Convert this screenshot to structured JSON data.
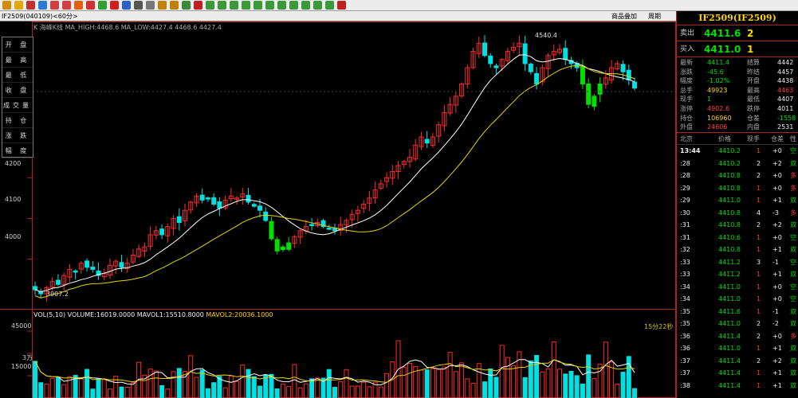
{
  "toolbar": {
    "icons": [
      "home-icon",
      "folder-icon",
      "grid-icon",
      "refresh-icon",
      "zoom-in-icon",
      "zoom-out-icon",
      "target-icon",
      "pencil-icon",
      "alert-icon",
      "filter-icon",
      "new-icon",
      "list-icon",
      "table-icon",
      "calendar-icon",
      "calendar-icon",
      "chart-icon",
      "close-icon",
      "1min-icon",
      "3min-icon",
      "5min-icon",
      "15min-icon",
      "30min-icon",
      "60min-icon",
      "day-icon",
      "week-icon",
      "month-icon",
      "quarter-icon",
      "year-icon",
      "settings-icon"
    ],
    "new_label": "新"
  },
  "tab": {
    "title": "IF2509(040109)<60分>",
    "overlay_label": "商品叠加",
    "period_label": "周期"
  },
  "menu": [
    "开 盘",
    "最 高",
    "最 低",
    "收 盘",
    "成交量",
    "持 仓",
    "涨 跌",
    "幅 度"
  ],
  "ma_line": "K 海峰K线  MA_HIGH:4468.6  MA_LOW:4427.4  4468.6  4427.4",
  "vol_line": {
    "a": "VOL(5,10) VOLUME:16019.0000",
    "b": "MAVOL1:15510.8000",
    "c": "MAVOL2:20036.1000"
  },
  "axis_price": [
    "4200",
    "4100",
    "4000"
  ],
  "axis_vol": [
    "45000",
    "3万",
    "15000"
  ],
  "peak_label": "4540.4",
  "low_label": "3907.2",
  "time_left": "15分22秒",
  "colors": {
    "up": "#ff2a2a",
    "down": "#00e0e0",
    "bull_green": "#00e000",
    "ma1": "#ffffff",
    "ma2": "#e6d300"
  },
  "chart_data": {
    "type": "candlestick",
    "price_ticks": [
      4000,
      4100,
      4200
    ],
    "volume_ticks": [
      15000,
      30000,
      45000
    ],
    "closes": [
      3925,
      3915,
      3930,
      3945,
      3938,
      3960,
      3975,
      3970,
      3990,
      3980,
      3975,
      3960,
      3965,
      3985,
      3995,
      3980,
      3990,
      4010,
      4025,
      4030,
      4060,
      4070,
      4060,
      4080,
      4100,
      4090,
      4120,
      4140,
      4155,
      4145,
      4150,
      4135,
      4125,
      4145,
      4155,
      4150,
      4160,
      4140,
      4130,
      4120,
      4095,
      4050,
      4020,
      4030,
      4040,
      4055,
      4070,
      4080,
      4085,
      4090,
      4080,
      4075,
      4070,
      4085,
      4095,
      4110,
      4120,
      4135,
      4150,
      4170,
      4185,
      4200,
      4215,
      4230,
      4240,
      4250,
      4280,
      4300,
      4285,
      4300,
      4330,
      4360,
      4380,
      4400,
      4430,
      4470,
      4510,
      4530,
      4500,
      4480,
      4470,
      4490,
      4510,
      4520,
      4530,
      4480,
      4460,
      4430,
      4470,
      4500,
      4510,
      4515,
      4490,
      4480,
      4470,
      4430,
      4380,
      4400,
      4430,
      4445,
      4470,
      4480,
      4460,
      4440,
      4420
    ],
    "current_price": 4411.6
  },
  "right": {
    "title": "IF2509(IF2509)",
    "sell_label": "卖出",
    "sell_price": "4411.6",
    "sell_qty": "2",
    "buy_label": "买入",
    "buy_price": "4411.0",
    "buy_qty": "1",
    "quote": [
      [
        "最新",
        "4411.4",
        "结算",
        "4442"
      ],
      [
        "涨跌",
        "-45.6",
        "昨结",
        "4457"
      ],
      [
        "幅度",
        "-1.02%",
        "开盘",
        "4438"
      ],
      [
        "总手",
        "49923",
        "最高",
        "4463"
      ],
      [
        "现手",
        "1",
        "最低",
        "4407"
      ],
      [
        "涨停",
        "4902.6",
        "跌停",
        "4011"
      ],
      [
        "持仓",
        "106960",
        "仓差",
        "-1558"
      ],
      [
        "外盘",
        "24606",
        "内盘",
        "2531"
      ]
    ],
    "ts_header": [
      "北京",
      "价格",
      "现手",
      "仓差",
      "性"
    ],
    "ticks": [
      [
        "13:44",
        "4410.2",
        "1",
        "+0",
        "空"
      ],
      [
        ":28",
        "4410.2",
        "2",
        "+2",
        "双"
      ],
      [
        ":28",
        "4410.8",
        "2",
        "+0",
        "多"
      ],
      [
        ":29",
        "4410.8",
        "1",
        "+0",
        "多"
      ],
      [
        ":29",
        "4411.0",
        "1",
        "+1",
        "双"
      ],
      [
        ":30",
        "4410.8",
        "4",
        "-3",
        "多"
      ],
      [
        ":31",
        "4410.8",
        "2",
        "+2",
        "双"
      ],
      [
        ":31",
        "4410.6",
        "1",
        "+0",
        "空"
      ],
      [
        ":32",
        "4410.8",
        "1",
        "+1",
        "双"
      ],
      [
        ":33",
        "4411.2",
        "3",
        "-1",
        "空"
      ],
      [
        ":33",
        "4411.2",
        "1",
        "+1",
        "双"
      ],
      [
        ":34",
        "4411.0",
        "1",
        "+0",
        "空"
      ],
      [
        ":34",
        "4411.0",
        "1",
        "+0",
        "空"
      ],
      [
        ":35",
        "4411.6",
        "1",
        "-1",
        "双"
      ],
      [
        ":35",
        "4411.0",
        "2",
        "-2",
        "双"
      ],
      [
        ":36",
        "4411.4",
        "2",
        "+0",
        "多"
      ],
      [
        ":36",
        "4411.0",
        "1",
        "+1",
        "双"
      ],
      [
        ":37",
        "4411.4",
        "2",
        "+2",
        "双"
      ],
      [
        ":37",
        "4411.4",
        "1",
        "+1",
        "双"
      ],
      [
        ":38",
        "4411.4",
        "1",
        "+1",
        "双"
      ]
    ]
  }
}
